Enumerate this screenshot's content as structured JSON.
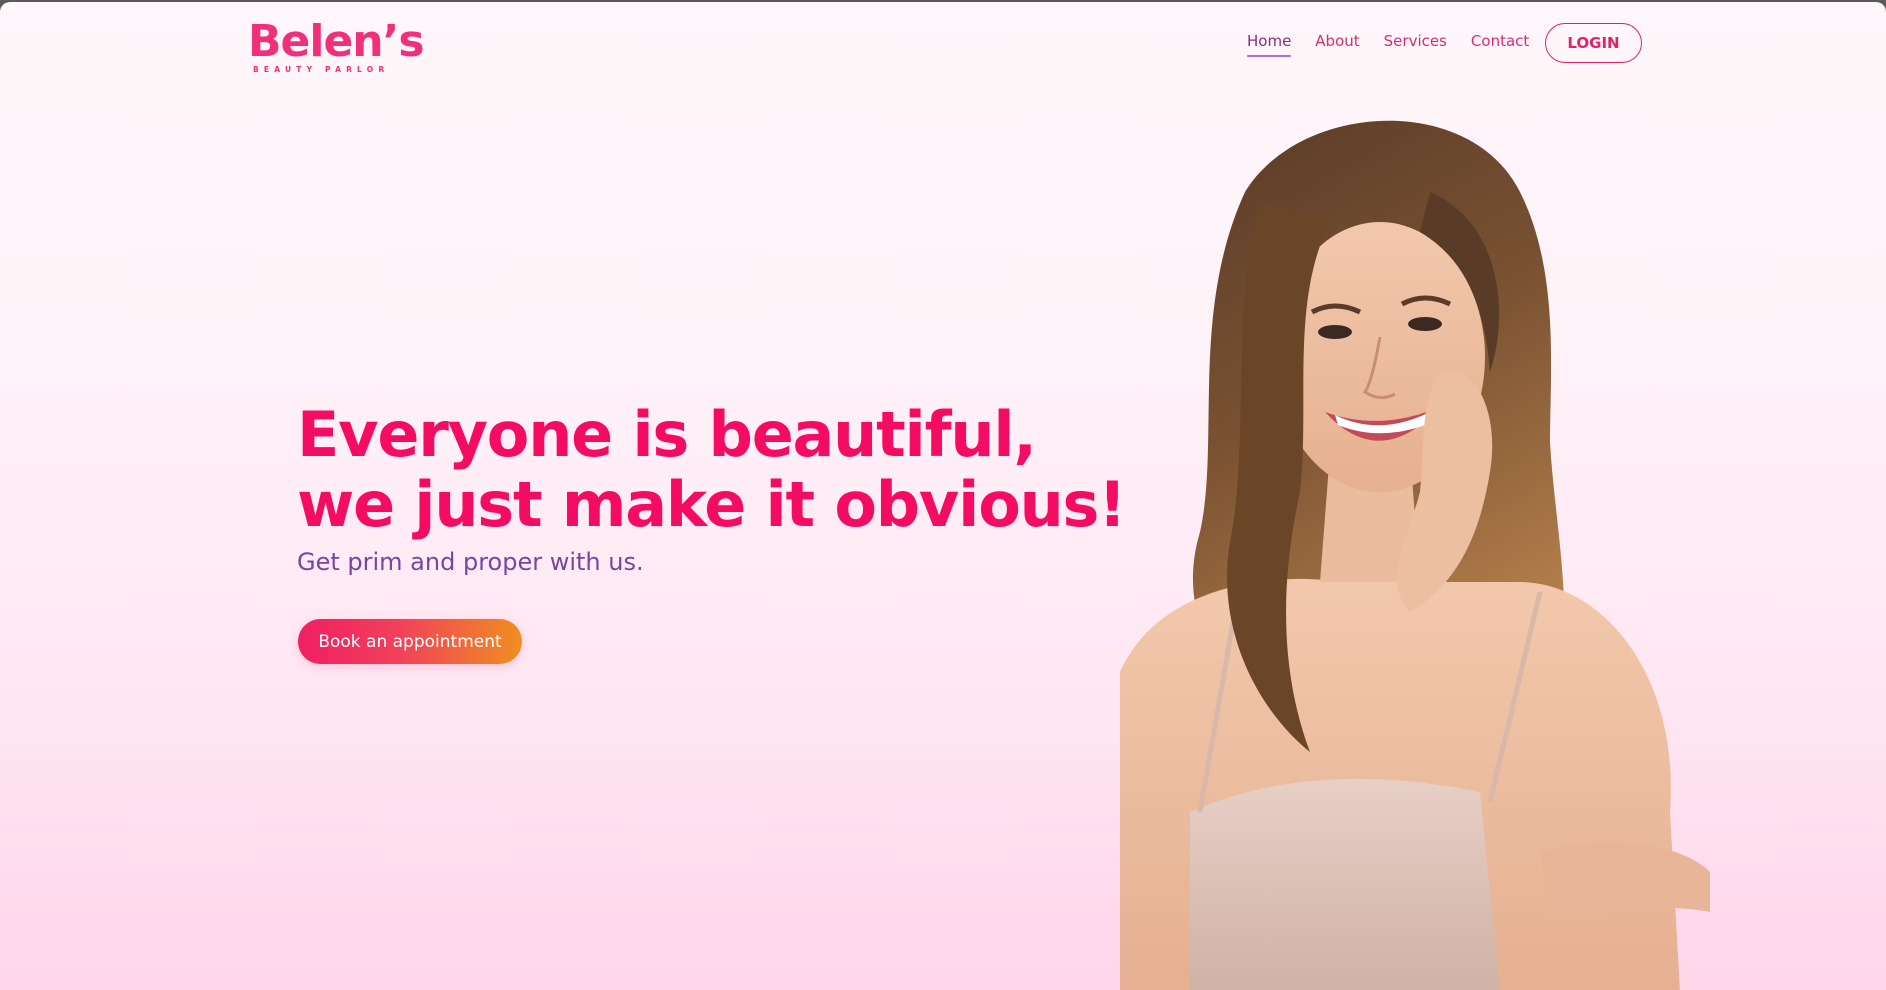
{
  "brand": {
    "name": "Belen’s",
    "tagline": "BEAUTY PARLOR",
    "color": "#f0307a"
  },
  "nav": {
    "items": [
      {
        "label": "Home",
        "active": true
      },
      {
        "label": "About",
        "active": false
      },
      {
        "label": "Services",
        "active": false
      },
      {
        "label": "Contact",
        "active": false
      }
    ],
    "login_label": "LOGIN"
  },
  "hero": {
    "title_line1": "Everyone is beautiful,",
    "title_line2": "we just make it obvious!",
    "subtitle": "Get prim and proper with us.",
    "cta_label": "Book an appointment",
    "image": "smiling-woman-portrait"
  },
  "colors": {
    "accent": "#f40b62",
    "subtitle": "#7a44a6",
    "cta_start": "#f01f63",
    "cta_end": "#ef8f1f"
  }
}
